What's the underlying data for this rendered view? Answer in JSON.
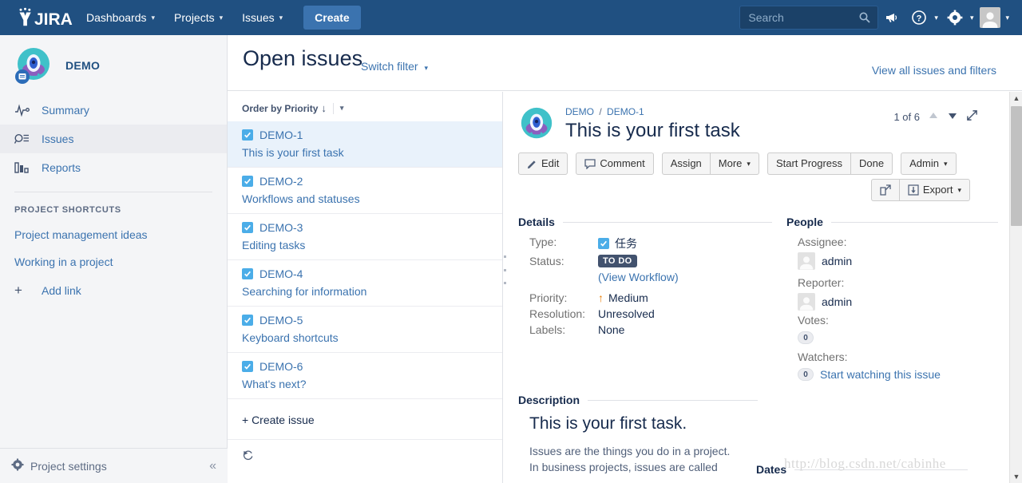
{
  "topnav": {
    "logo_text": "JIRA",
    "items": [
      {
        "label": "Dashboards",
        "caret": "▾"
      },
      {
        "label": "Projects",
        "caret": "▾"
      },
      {
        "label": "Issues",
        "caret": "▾"
      }
    ],
    "create_label": "Create",
    "search_placeholder": "Search",
    "search_value": "",
    "icons": [
      "megaphone-icon",
      "help-icon",
      "settings-icon",
      "profile-icon"
    ]
  },
  "sidebar": {
    "project_name": "DEMO",
    "items": [
      {
        "label": "Summary",
        "icon": "activity-icon",
        "active": false
      },
      {
        "label": "Issues",
        "icon": "issues-search-icon",
        "active": true
      },
      {
        "label": "Reports",
        "icon": "bar-chart-icon",
        "active": false
      }
    ],
    "shortcuts_header": "PROJECT SHORTCUTS",
    "shortcuts": [
      {
        "label": "Project management ideas"
      },
      {
        "label": "Working in a project"
      }
    ],
    "add_link_label": "Add link",
    "settings_label": "Project settings",
    "collapse_icon": "«"
  },
  "page": {
    "title": "Open issues",
    "switch_filter": "Switch filter",
    "view_all": "View all issues and filters"
  },
  "issue_list": {
    "order_by": "Order by Priority",
    "order_arrow": "↓",
    "issues": [
      {
        "key": "DEMO-1",
        "summary": "This is your first task",
        "selected": true
      },
      {
        "key": "DEMO-2",
        "summary": "Workflows and statuses",
        "selected": false
      },
      {
        "key": "DEMO-3",
        "summary": "Editing tasks",
        "selected": false
      },
      {
        "key": "DEMO-4",
        "summary": "Searching for information",
        "selected": false
      },
      {
        "key": "DEMO-5",
        "summary": "Keyboard shortcuts",
        "selected": false
      },
      {
        "key": "DEMO-6",
        "summary": "What's next?",
        "selected": false
      }
    ],
    "create_issue": "+ Create issue"
  },
  "detail": {
    "breadcrumb_project": "DEMO",
    "breadcrumb_sep": "/",
    "breadcrumb_issue": "DEMO-1",
    "title": "This is your first task",
    "pager_text": "1 of 6",
    "toolbar": {
      "edit": "Edit",
      "comment": "Comment",
      "assign": "Assign",
      "more": "More",
      "start_progress": "Start Progress",
      "done": "Done",
      "admin": "Admin",
      "export": "Export"
    },
    "details": {
      "heading": "Details",
      "type_label": "Type:",
      "type_value": "任务",
      "status_label": "Status:",
      "status_value": "TO DO",
      "view_workflow": "(View Workflow)",
      "priority_label": "Priority:",
      "priority_value": "Medium",
      "priority_arrow": "↑",
      "resolution_label": "Resolution:",
      "resolution_value": "Unresolved",
      "labels_label": "Labels:",
      "labels_value": "None"
    },
    "people": {
      "heading": "People",
      "assignee_label": "Assignee:",
      "assignee_value": "admin",
      "reporter_label": "Reporter:",
      "reporter_value": "admin",
      "votes_label": "Votes:",
      "votes_value": "0",
      "watchers_label": "Watchers:",
      "watchers_value": "0",
      "watch_link": "Start watching this issue"
    },
    "description": {
      "heading": "Description",
      "title": "This is your first task.",
      "body_line1": "Issues are the things you do in a project.",
      "body_line2": "In business projects, issues are called"
    },
    "dates_heading": "Dates"
  },
  "watermark": "http://blog.csdn.net/cabinhe",
  "colors": {
    "nav_bg": "#205081",
    "accent_blue": "#3b73af",
    "link_blue": "#3b73af",
    "type_blue": "#4bade8",
    "status_dark": "#42526e",
    "priority_orange": "#e9800b",
    "selected_row": "#e9f2fb"
  }
}
